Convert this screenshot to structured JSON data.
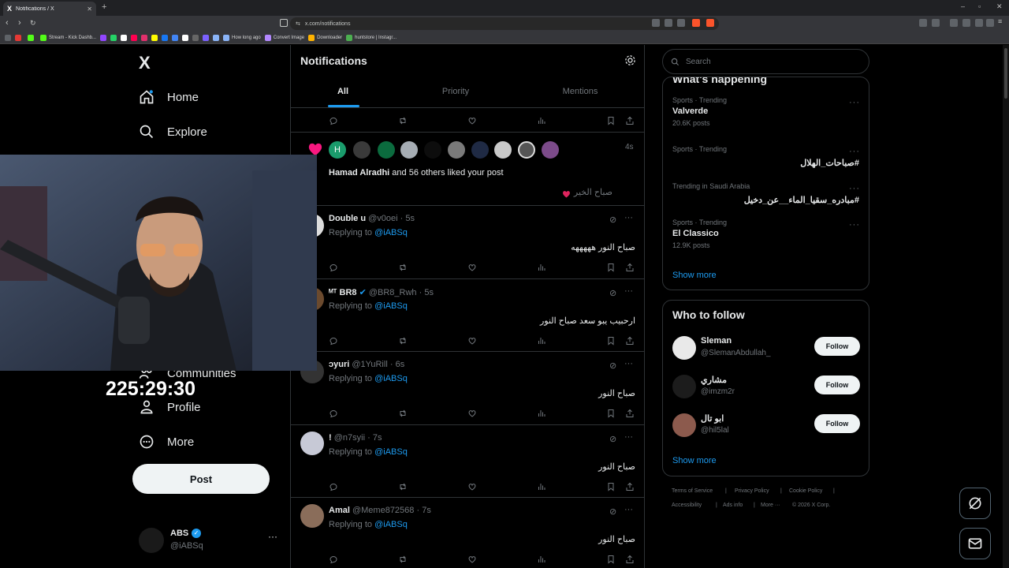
{
  "browser": {
    "tab_title": "Notifications / X",
    "tab_favicon": "X",
    "url": "x.com/notifications",
    "bookmarks": [
      {
        "label": "",
        "color": "#e53935"
      },
      {
        "label": "",
        "color": "#53fc18"
      },
      {
        "label": "Stream - Kick Dashb...",
        "color": "#53fc18"
      },
      {
        "label": "",
        "color": "#9146ff"
      },
      {
        "label": "",
        "color": "#25d366"
      },
      {
        "label": "",
        "color": "#ffffff"
      },
      {
        "label": "",
        "color": "#ff0050"
      },
      {
        "label": "",
        "color": "#e1306c"
      },
      {
        "label": "",
        "color": "#fffc00"
      },
      {
        "label": "",
        "color": "#1877f2"
      },
      {
        "label": "",
        "color": "#4285f4"
      },
      {
        "label": "",
        "color": "#ffffff"
      },
      {
        "label": "",
        "color": "#666666"
      },
      {
        "label": "",
        "color": "#7b61ff"
      },
      {
        "label": "",
        "color": "#8ab4f8"
      },
      {
        "label": "How long ago",
        "color": "#8ab4f8"
      },
      {
        "label": "Convert Image",
        "color": "#b388ff"
      },
      {
        "label": "Downloader",
        "color": "#ffb300"
      },
      {
        "label": "huntstore | Instagr...",
        "color": "#4caf50"
      }
    ]
  },
  "sidebar": {
    "logo": "X",
    "items": [
      {
        "label": "Home",
        "icon": "home-icon"
      },
      {
        "label": "Explore",
        "icon": "search-icon"
      },
      {
        "label": "Communities",
        "icon": "communities-icon"
      },
      {
        "label": "Profile",
        "icon": "profile-icon"
      },
      {
        "label": "More",
        "icon": "more-circle-icon"
      }
    ],
    "post_label": "Post",
    "account": {
      "name": "ABS",
      "handle": "@iABSq"
    }
  },
  "overlay": {
    "timer": "225:29:30"
  },
  "center": {
    "title": "Notifications",
    "tabs": [
      "All",
      "Priority",
      "Mentions"
    ],
    "active_tab": "All",
    "like_notification": {
      "avatar_letter": "H",
      "time": "4s",
      "actor": "Hamad Alradhi",
      "text": "and 56 others liked your post",
      "post_snippet": "صباح الخير"
    },
    "replies": [
      {
        "name": "Double u",
        "handle": "@v0oei",
        "time": "5s",
        "replying_label": "Replying to",
        "replying_to": "@iABSq",
        "text": "صباح النور هههههه"
      },
      {
        "name": "ᴹᵀ BR8",
        "handle": "@BR8_Rwh",
        "time": "5s",
        "replying_label": "Replying to",
        "replying_to": "@iABSq",
        "text": "ارحبيب يبو سعد صباح النور"
      },
      {
        "name": "ɔyuri",
        "handle": "@1YuRill",
        "time": "6s",
        "replying_label": "Replying to",
        "replying_to": "@iABSq",
        "text": "صباح النور"
      },
      {
        "name": "!",
        "handle": "@n7syii",
        "time": "7s",
        "replying_label": "Replying to",
        "replying_to": "@iABSq",
        "text": "صباح النور"
      },
      {
        "name": "Amal",
        "handle": "@Meme872568",
        "time": "7s",
        "replying_label": "Replying to",
        "replying_to": "@iABSq",
        "text": "صباح النور"
      }
    ]
  },
  "right": {
    "search_placeholder": "Search",
    "trends_heading": "What's happening",
    "trends": [
      {
        "category": "Sports · Trending",
        "name": "Valverde",
        "count": "20.6K posts"
      },
      {
        "category": "Sports · Trending",
        "name": "#صباحات_الهلال",
        "count": ""
      },
      {
        "category": "Trending in Saudi Arabia",
        "name": "#مبادره_سقيا_الماء__عن_دخيل",
        "count": ""
      },
      {
        "category": "Sports · Trending",
        "name": "El Classico",
        "count": "12.9K posts"
      }
    ],
    "show_more": "Show more",
    "who_to_follow": {
      "title": "Who to follow",
      "users": [
        {
          "name": "Sleman",
          "handle": "@SlemanAbdullah_",
          "button": "Follow"
        },
        {
          "name": "مشاري",
          "handle": "@imzm2r",
          "button": "Follow"
        },
        {
          "name": "ابو تال",
          "handle": "@hil5lal",
          "button": "Follow"
        }
      ],
      "show_more": "Show more"
    },
    "footer": {
      "links": [
        "Terms of Service",
        "Privacy Policy",
        "Cookie Policy",
        "Accessibility",
        "Ads info",
        "More ···"
      ],
      "copyright": "© 2026 X Corp."
    }
  },
  "colors": {
    "accent": "#1d9bf0",
    "like": "#f91880",
    "border": "#2f3336",
    "muted": "#71767b"
  }
}
